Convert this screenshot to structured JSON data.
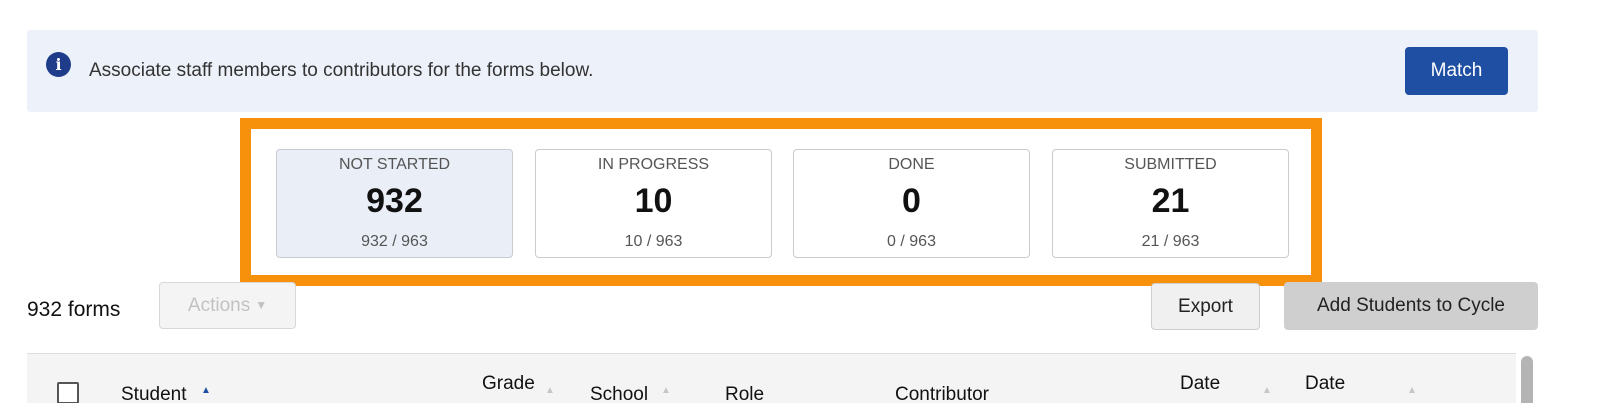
{
  "banner": {
    "icon": "info-icon",
    "message": "Associate staff members to contributors for the forms below.",
    "match_label": "Match",
    "colors": {
      "background": "#edf1f9",
      "button": "#1e4fa3"
    }
  },
  "highlight_color": "#f7900a",
  "stats": [
    {
      "label": "NOT STARTED",
      "value": "932",
      "sub": "932 / 963",
      "active": true
    },
    {
      "label": "IN PROGRESS",
      "value": "10",
      "sub": "10 / 963",
      "active": false
    },
    {
      "label": "DONE",
      "value": "0",
      "sub": "0 / 963",
      "active": false
    },
    {
      "label": "SUBMITTED",
      "value": "21",
      "sub": "21 / 963",
      "active": false
    }
  ],
  "toolbar": {
    "forms_count": "932 forms",
    "actions_label": "Actions",
    "export_label": "Export",
    "add_students_label": "Add Students to Cycle"
  },
  "table": {
    "headers": {
      "student": "Student",
      "grade": "Grade",
      "school": "School",
      "role": "Role",
      "contributor": "Contributor",
      "date1": "Date",
      "date2": "Date"
    }
  }
}
